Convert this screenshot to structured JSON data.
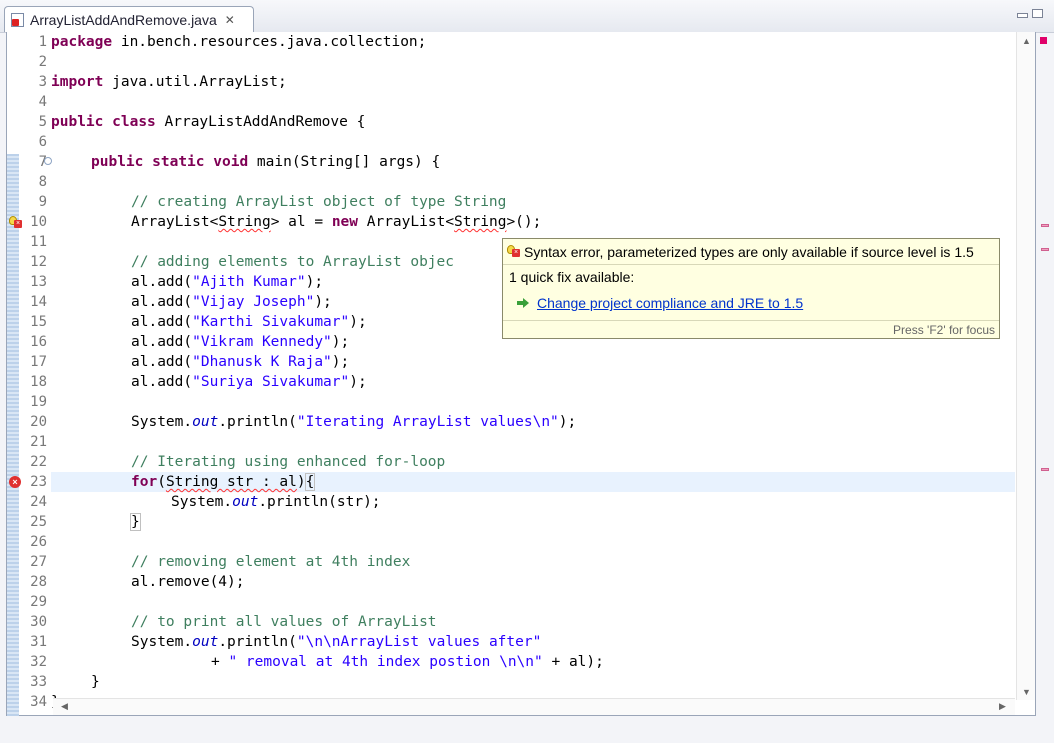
{
  "tab": {
    "title": "ArrayListAddAndRemove.java",
    "close": "✕"
  },
  "tooltip": {
    "message": "Syntax error, parameterized types are only available if source level is 1.5",
    "quickfix_count": "1 quick fix available:",
    "fix_link": "Change project compliance and JRE to 1.5",
    "footer": "Press 'F2' for focus"
  },
  "lines": [
    {
      "n": "1"
    },
    {
      "n": "2"
    },
    {
      "n": "3"
    },
    {
      "n": "4"
    },
    {
      "n": "5"
    },
    {
      "n": "6"
    },
    {
      "n": "7"
    },
    {
      "n": "8"
    },
    {
      "n": "9"
    },
    {
      "n": "10"
    },
    {
      "n": "11"
    },
    {
      "n": "12"
    },
    {
      "n": "13"
    },
    {
      "n": "14"
    },
    {
      "n": "15"
    },
    {
      "n": "16"
    },
    {
      "n": "17"
    },
    {
      "n": "18"
    },
    {
      "n": "19"
    },
    {
      "n": "20"
    },
    {
      "n": "21"
    },
    {
      "n": "22"
    },
    {
      "n": "23"
    },
    {
      "n": "24"
    },
    {
      "n": "25"
    },
    {
      "n": "26"
    },
    {
      "n": "27"
    },
    {
      "n": "28"
    },
    {
      "n": "29"
    },
    {
      "n": "30"
    },
    {
      "n": "31"
    },
    {
      "n": "32"
    },
    {
      "n": "33"
    },
    {
      "n": "34"
    }
  ],
  "code": {
    "l1_kw": "package",
    "l1_rest": " in.bench.resources.java.collection;",
    "l3_kw": "import",
    "l3_rest": " java.util.ArrayList;",
    "l5_kw1": "public",
    "l5_kw2": "class",
    "l5_rest": " ArrayListAddAndRemove {",
    "l7_kw1": "public",
    "l7_kw2": "static",
    "l7_kw3": "void",
    "l7_rest": " main(String[] args) {",
    "l9_cm": "// creating ArrayList object of type String",
    "l10_a": "ArrayList<",
    "l10_err1": "String",
    "l10_b": "> al = ",
    "l10_kw": "new",
    "l10_c": " ArrayList<",
    "l10_err2": "String",
    "l10_d": ">();",
    "l12_cm": "// adding elements to ArrayList objec",
    "l13_a": "al.add(",
    "l13_s": "\"Ajith Kumar\"",
    "l13_b": ");",
    "l14_a": "al.add(",
    "l14_s": "\"Vijay Joseph\"",
    "l14_b": ");",
    "l15_a": "al.add(",
    "l15_s": "\"Karthi Sivakumar\"",
    "l15_b": ");",
    "l16_a": "al.add(",
    "l16_s": "\"Vikram Kennedy\"",
    "l16_b": ");",
    "l17_a": "al.add(",
    "l17_s": "\"Dhanusk K Raja\"",
    "l17_b": ");",
    "l18_a": "al.add(",
    "l18_s": "\"Suriya Sivakumar\"",
    "l18_b": ");",
    "l20_a": "System.",
    "l20_f": "out",
    "l20_b": ".println(",
    "l20_s": "\"Iterating ArrayList values\\n\"",
    "l20_c": ");",
    "l22_cm": "// Iterating using enhanced for-loop",
    "l23_kw": "for",
    "l23_a": "(",
    "l23_err": "String str : al",
    "l23_b": ")",
    "l24_a": "System.",
    "l24_f": "out",
    "l24_b": ".println(str);",
    "l25": "}",
    "l27_cm": "// removing element at 4th index",
    "l28": "al.remove(4);",
    "l30_cm": "// to print all values of ArrayList",
    "l31_a": "System.",
    "l31_f": "out",
    "l31_b": ".println(",
    "l31_s": "\"\\n\\nArrayList values after\"",
    "l32_a": "+ ",
    "l32_s": "\" removal at 4th index postion \\n\\n\"",
    "l32_b": " + al);",
    "l33": "}",
    "l34": "}"
  }
}
